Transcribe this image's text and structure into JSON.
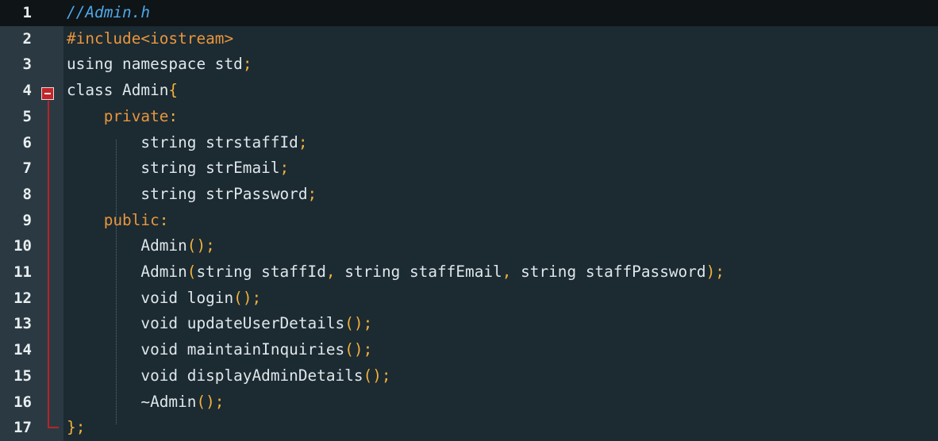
{
  "editor": {
    "file_comment": "//Admin.h",
    "current_line": 1,
    "lines": [
      {
        "num": "1",
        "tokens": [
          {
            "t": "//Admin.h",
            "c": "comment"
          }
        ]
      },
      {
        "num": "2",
        "tokens": [
          {
            "t": "#include<iostream>",
            "c": "pre"
          }
        ]
      },
      {
        "num": "3",
        "tokens": [
          {
            "t": "using namespace std",
            "c": "text"
          },
          {
            "t": ";",
            "c": "punc"
          }
        ]
      },
      {
        "num": "4",
        "tokens": [
          {
            "t": "class Admin",
            "c": "text"
          },
          {
            "t": "{",
            "c": "punc"
          }
        ]
      },
      {
        "num": "5",
        "tokens": [
          {
            "t": "    private",
            "c": "kw"
          },
          {
            "t": ":",
            "c": "punc"
          }
        ]
      },
      {
        "num": "6",
        "tokens": [
          {
            "t": "        string strstaffId",
            "c": "text"
          },
          {
            "t": ";",
            "c": "punc"
          }
        ]
      },
      {
        "num": "7",
        "tokens": [
          {
            "t": "        string strEmail",
            "c": "text"
          },
          {
            "t": ";",
            "c": "punc"
          }
        ]
      },
      {
        "num": "8",
        "tokens": [
          {
            "t": "        string strPassword",
            "c": "text"
          },
          {
            "t": ";",
            "c": "punc"
          }
        ]
      },
      {
        "num": "9",
        "tokens": [
          {
            "t": "    public",
            "c": "kw"
          },
          {
            "t": ":",
            "c": "punc"
          }
        ]
      },
      {
        "num": "10",
        "tokens": [
          {
            "t": "        Admin",
            "c": "text"
          },
          {
            "t": "();",
            "c": "punc"
          }
        ]
      },
      {
        "num": "11",
        "tokens": [
          {
            "t": "        Admin",
            "c": "text"
          },
          {
            "t": "(",
            "c": "punc"
          },
          {
            "t": "string staffId",
            "c": "text"
          },
          {
            "t": ",",
            "c": "punc"
          },
          {
            "t": " string staffEmail",
            "c": "text"
          },
          {
            "t": ",",
            "c": "punc"
          },
          {
            "t": " string staffPassword",
            "c": "text"
          },
          {
            "t": ");",
            "c": "punc"
          }
        ]
      },
      {
        "num": "12",
        "tokens": [
          {
            "t": "        void login",
            "c": "text"
          },
          {
            "t": "();",
            "c": "punc"
          }
        ]
      },
      {
        "num": "13",
        "tokens": [
          {
            "t": "        void updateUserDetails",
            "c": "text"
          },
          {
            "t": "();",
            "c": "punc"
          }
        ]
      },
      {
        "num": "14",
        "tokens": [
          {
            "t": "        void maintainInquiries",
            "c": "text"
          },
          {
            "t": "();",
            "c": "punc"
          }
        ]
      },
      {
        "num": "15",
        "tokens": [
          {
            "t": "        void displayAdminDetails",
            "c": "text"
          },
          {
            "t": "();",
            "c": "punc"
          }
        ]
      },
      {
        "num": "16",
        "tokens": [
          {
            "t": "        ~Admin",
            "c": "text"
          },
          {
            "t": "();",
            "c": "punc"
          }
        ]
      },
      {
        "num": "17",
        "tokens": [
          {
            "t": "}",
            "c": "punc"
          },
          {
            "t": ";",
            "c": "punc"
          }
        ]
      }
    ]
  },
  "colors": {
    "background": "#1c2a32",
    "gutter": "#2b3a42",
    "comment": "#4fa8e8",
    "keyword": "#e8963c",
    "punctuation": "#f2b23a",
    "text": "#dfe7ea",
    "fold_marker": "#c0262b"
  },
  "icons": {
    "fold_marker": "collapse-minus-icon"
  }
}
